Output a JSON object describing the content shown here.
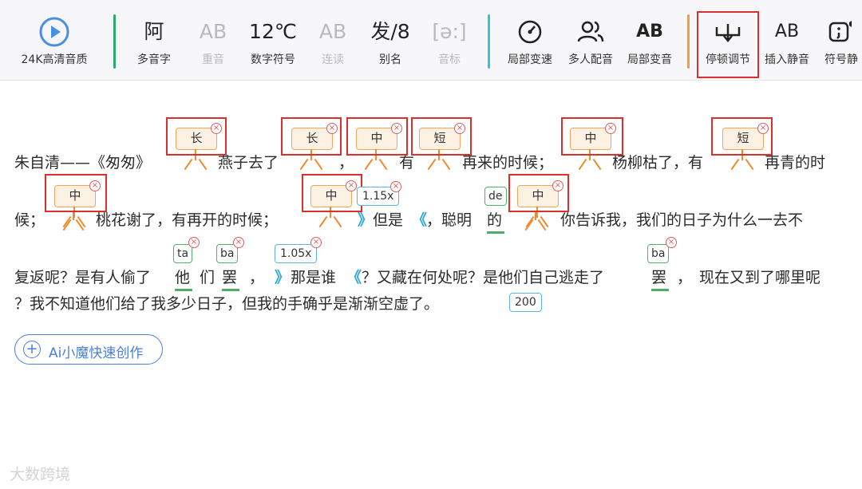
{
  "toolbar": {
    "quality": {
      "label": "24K高清音质"
    },
    "items": [
      {
        "icon": "阿",
        "label": "多音字"
      },
      {
        "icon": "AB",
        "label": "重音"
      },
      {
        "icon": "12℃",
        "label": "数字符号"
      },
      {
        "icon": "AB",
        "label": "连读"
      },
      {
        "icon": "发/8",
        "label": "别名"
      },
      {
        "icon": "[ə:]",
        "label": "音标"
      },
      {
        "icon": "gauge-icon",
        "label": "局部变速"
      },
      {
        "icon": "multi-voice-icon",
        "label": "多人配音"
      },
      {
        "icon": "AB",
        "label": "局部变音"
      },
      {
        "icon": "pause-icon",
        "label": "停顿调节"
      },
      {
        "icon": "AB",
        "label": "插入静音"
      },
      {
        "icon": "symbol-icon",
        "label": "符号静"
      }
    ],
    "separator_colors": [
      "#2fa96b",
      "#34c4d9",
      "#f0a03c"
    ]
  },
  "pauses": {
    "chang": "长",
    "zhong": "中",
    "duan": "短",
    "close": "×"
  },
  "text": {
    "l1": {
      "a": "朱自清——《匆匆》",
      "b": "燕子去了",
      "c": "，",
      "d": "有",
      "e": "再来的时候；",
      "f": "杨柳枯了，有",
      "g": "再青的时"
    },
    "l2": {
      "a": "候；",
      "b": "桃花谢了，有再开的时候；",
      "c": "但是",
      "d": "，聪明",
      "e": "的",
      "f": "你告诉我，我们的日子为什么一去不"
    },
    "l3": {
      "a": "复返呢？是有人偷了",
      "b": "他",
      "c": "们",
      "d": "罢",
      "e": "，",
      "f": "那是谁",
      "g": "？又藏在何处呢？是他们自己逃走了",
      "h": "罢",
      "i": "，",
      "j": "现在又到了哪里呢"
    },
    "l4": {
      "a": "？我不知道他们给了我多少日子，但我的手确乎是渐渐空虚了。"
    }
  },
  "badges": {
    "speed1": "1.15x",
    "speed2": "1.05x",
    "pause_ms": "200",
    "pinyin_de": "de",
    "pinyin_ta": "ta",
    "pinyin_ba1": "ba",
    "pinyin_ba2": "ba"
  },
  "markers": {
    "open": "》",
    "close": "《"
  },
  "ai_button": {
    "label": "Ai小魔快速创作"
  },
  "watermark": "大数跨境",
  "colors": {
    "accent": "#4b7fd9",
    "highlight": "#d8302a",
    "pause_tag": "#f0a55b",
    "pinyin": "#52b36a",
    "speed": "#5cb3e6"
  }
}
